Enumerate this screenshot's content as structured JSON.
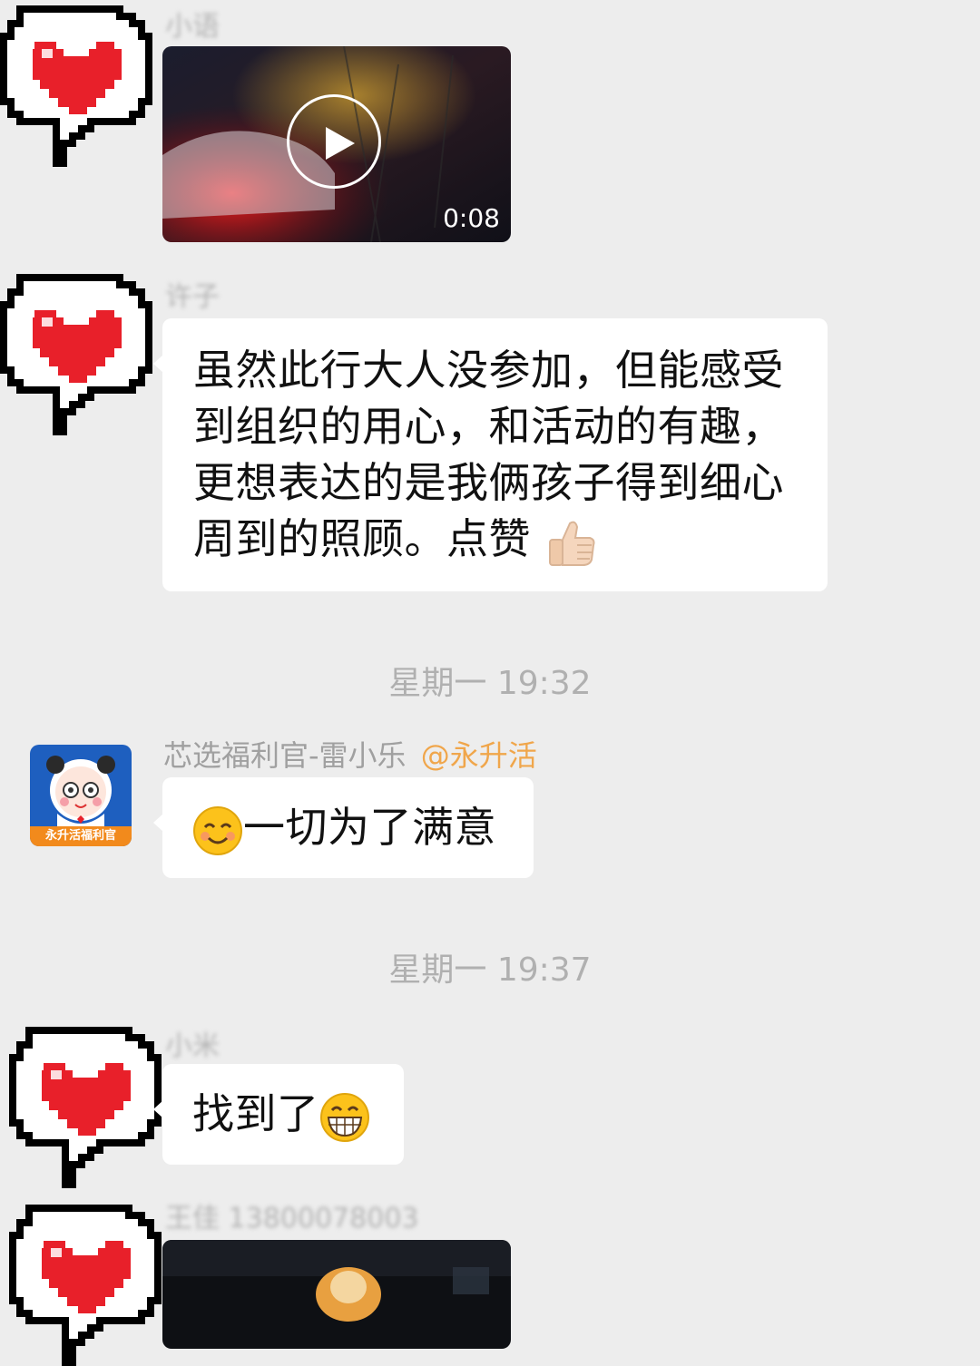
{
  "messages": [
    {
      "type": "video",
      "sender": "小语",
      "duration": "0:08"
    },
    {
      "type": "text",
      "sender": "许子",
      "lines": [
        "虽然此行大人没参加，但能感受",
        "到组织的用心，和活动的有趣，",
        "更想表达的是我俩孩子得到细心",
        "周到的照顾。点赞"
      ],
      "trailing_emoji": "thumbs-up"
    },
    {
      "type": "time",
      "text": "星期一 19:32"
    },
    {
      "type": "text",
      "sender": "芯选福利官-雷小乐",
      "mention": "@永升活",
      "avatar_label": "永升活福利官",
      "leading_emoji": "smiling-face",
      "text": "一切为了满意"
    },
    {
      "type": "time",
      "text": "星期一 19:37"
    },
    {
      "type": "text",
      "sender": "小米",
      "text": "找到了",
      "trailing_emoji": "grinning-face"
    },
    {
      "type": "video",
      "sender": "王佳 13800078003"
    }
  ],
  "colors": {
    "background": "#ededed",
    "bubble": "#ffffff",
    "mention": "#f0a64b",
    "time": "#b0b0b0",
    "sender": "#a0a0a0"
  }
}
